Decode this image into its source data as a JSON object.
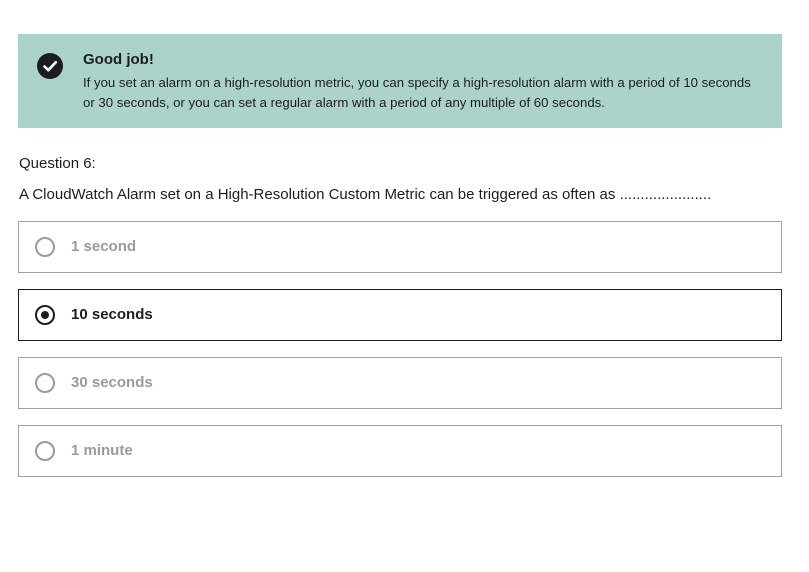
{
  "feedback": {
    "title": "Good job!",
    "text": "If you set an alarm on a high-resolution metric, you can specify a high-resolution alarm with a period of 10 seconds or 30 seconds, or you can set a regular alarm with a period of any multiple of 60 seconds.",
    "icon": "check-circle-icon",
    "background_color": "#acd2cc"
  },
  "question": {
    "label": "Question 6:",
    "text": "A CloudWatch Alarm set on a High-Resolution Custom Metric can be triggered as often as ......................"
  },
  "answers": [
    {
      "label": "1 second",
      "selected": false
    },
    {
      "label": "10 seconds",
      "selected": true
    },
    {
      "label": "30 seconds",
      "selected": false
    },
    {
      "label": "1 minute",
      "selected": false
    }
  ]
}
